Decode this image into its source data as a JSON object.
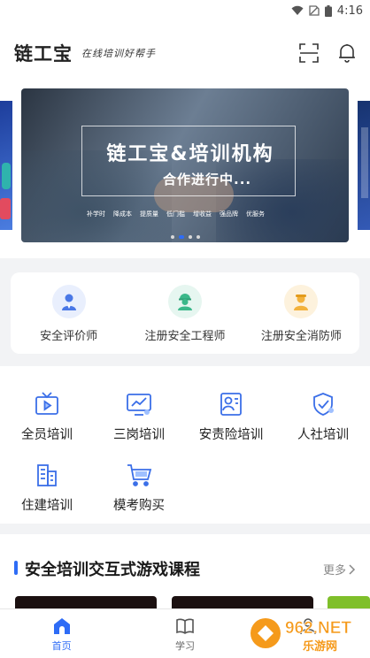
{
  "status_bar": {
    "time": "4:16"
  },
  "header": {
    "logo": "链工宝",
    "slogan": "在线培训好帮手"
  },
  "banner": {
    "title": "链工宝&培训机构",
    "subtitle": "合作进行中...",
    "tags": [
      "补学时",
      "降成本",
      "提质量",
      "低门槛",
      "增收益",
      "强品牌",
      "优服务"
    ],
    "slides": 4,
    "active_slide": 1
  },
  "roles": [
    {
      "label": "安全评价师",
      "icon": "evaluator-avatar-icon",
      "color": "#e9effd"
    },
    {
      "label": "注册安全工程师",
      "icon": "engineer-avatar-icon",
      "color": "#e6f6f0"
    },
    {
      "label": "注册安全消防师",
      "icon": "firefighter-avatar-icon",
      "color": "#fdf2dd"
    }
  ],
  "training_grid": [
    {
      "label": "全员培训",
      "icon": "tv-play-icon"
    },
    {
      "label": "三岗培训",
      "icon": "monitor-chart-icon"
    },
    {
      "label": "安责险培训",
      "icon": "certificate-icon"
    },
    {
      "label": "人社培训",
      "icon": "shield-check-icon"
    },
    {
      "label": "住建培训",
      "icon": "building-icon"
    },
    {
      "label": "模考购买",
      "icon": "shopping-cart-icon"
    }
  ],
  "games_section": {
    "title": "安全培训交互式游戏课程",
    "more": "更多"
  },
  "tab_bar": [
    {
      "label": "首页",
      "icon": "home-icon",
      "active": true
    },
    {
      "label": "学习",
      "icon": "book-icon",
      "active": false
    },
    {
      "label": "",
      "icon": "profile-icon",
      "active": false
    }
  ],
  "watermark": {
    "text": "962.NET",
    "subtext": "乐游网"
  },
  "colors": {
    "accent": "#2e6cf6",
    "icon_blue": "#3b6fe8"
  }
}
